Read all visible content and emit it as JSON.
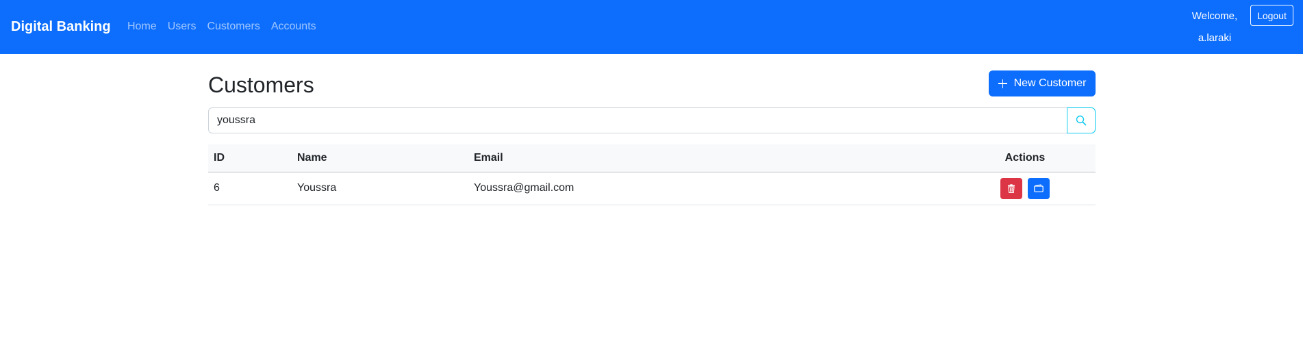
{
  "navbar": {
    "brand": "Digital Banking",
    "links": [
      {
        "label": "Home"
      },
      {
        "label": "Users"
      },
      {
        "label": "Customers"
      },
      {
        "label": "Accounts"
      }
    ],
    "welcome_label": "Welcome,",
    "username": "a.laraki",
    "logout_label": "Logout",
    "bg_color": "#0d6efd"
  },
  "main": {
    "title": "Customers",
    "new_button_label": "New Customer",
    "search": {
      "value": "youssra",
      "button_icon": "search-icon"
    },
    "table": {
      "columns": [
        "ID",
        "Name",
        "Email",
        "Actions"
      ],
      "rows": [
        {
          "id": "6",
          "name": "Youssra",
          "email": "Youssra@gmail.com",
          "actions": [
            {
              "icon": "trash-icon",
              "color": "#dc3545"
            },
            {
              "icon": "wallet-icon",
              "color": "#0d6efd"
            }
          ]
        }
      ]
    }
  }
}
